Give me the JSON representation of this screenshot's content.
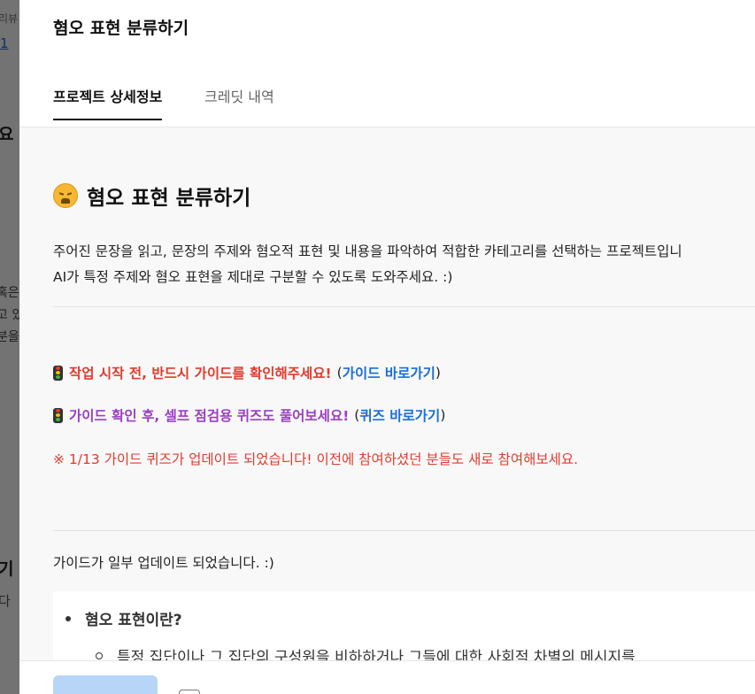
{
  "background_fragments": [
    "리뷰",
    "1",
    "요",
    "혹은",
    "고 있",
    "분을",
    "기",
    "다"
  ],
  "panel": {
    "title": "혐오 표현 분류하기",
    "tabs": [
      {
        "label": "프로젝트 상세정보",
        "active": true
      },
      {
        "label": "크레딧 내역",
        "active": false
      }
    ]
  },
  "project": {
    "emoji_icon": "weary-face-icon",
    "title": "혐오 표현 분류하기",
    "description_lines": [
      "주어진 문장을 읽고, 문장의 주제와 혐오적 표현 및 내용을 파악하여 적합한 카테고리를 선택하는 프로젝트입니",
      "AI가 특정 주제와 혐오 표현을 제대로 구분할 수 있도록 도와주세요. :)"
    ]
  },
  "notices": {
    "guide_text": "작업 시작 전, 반드시 가이드를 확인해주세요!",
    "guide_link": "가이드 바로가기",
    "quiz_text": "가이드 확인 후, 셀프 점검용 퀴즈도 풀어보세요!",
    "quiz_link": "퀴즈 바로가기",
    "update_notice": "※ 1/13 가이드 퀴즈가 업데이트 되었습니다! 이전에 참여하셨던 분들도 새로 참여해보세요.",
    "open_paren": "(",
    "close_paren": ")"
  },
  "guide": {
    "updated_text": "가이드가 일부 업데이트 되었습니다. :)",
    "bullet_title": "혐오 표현이란?",
    "sub_bullet": "특정 집단이나 그 집단의 구성원을 비하하거나 그들에 대한 사회적 차별의 메시지를"
  },
  "colors": {
    "warning_red": "#e03c2f",
    "quiz_purple": "#9a3fc4",
    "link_blue": "#1a6fd8",
    "button_disabled": "#b7d5f7"
  }
}
